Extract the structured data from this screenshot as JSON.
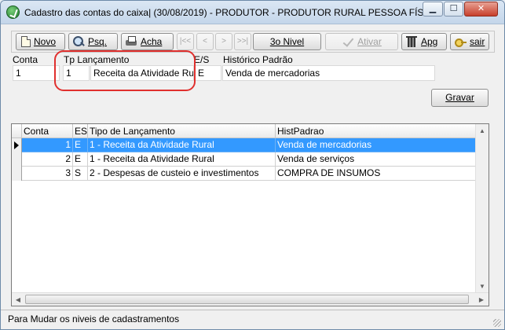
{
  "window": {
    "title": "Cadastro das contas do caixa| (30/08/2019) - PRODUTOR - PRODUTOR RURAL PESSOA FÍSICA",
    "min_icon": "minimize-icon",
    "max_icon": "maximize-icon",
    "close_label": "✕"
  },
  "toolbar": {
    "novo_label": "Novo",
    "psq_label": "Psq.",
    "acha_label": "Acha",
    "nav_first": "|<<",
    "nav_prev": "<",
    "nav_next": ">",
    "nav_last": ">>|",
    "nivel_label": "3o Nivel",
    "ativar_label": "Ativar",
    "apg_label": "Apg",
    "sair_label": "sair"
  },
  "form": {
    "conta_label": "Conta",
    "conta_value": "1",
    "tp_label": "Tp Lançamento",
    "tp_code": "1",
    "tp_desc": "Receita da Atividade Rural",
    "es_label": "E/S",
    "es_value": "E",
    "hist_label": "Histórico Padrão",
    "hist_value": "Venda de mercadorias",
    "gravar_label": "Gravar"
  },
  "grid": {
    "columns": [
      "Conta",
      "ES",
      "Tipo de Lançamento",
      "HistPadrao"
    ],
    "rows": [
      {
        "conta": "1",
        "es": "E",
        "tipo": "1 - Receita da Atividade Rural",
        "hist": "Venda de mercadorias"
      },
      {
        "conta": "2",
        "es": "E",
        "tipo": "1 - Receita da Atividade Rural",
        "hist": "Venda de serviços"
      },
      {
        "conta": "3",
        "es": "S",
        "tipo": "2 - Despesas de custeio e investimentos",
        "hist": "COMPRA DE INSUMOS"
      }
    ]
  },
  "status": {
    "text": "Para Mudar os niveis de cadastramentos"
  },
  "colors": {
    "selection": "#3399ff",
    "highlight": "#e0302e"
  }
}
